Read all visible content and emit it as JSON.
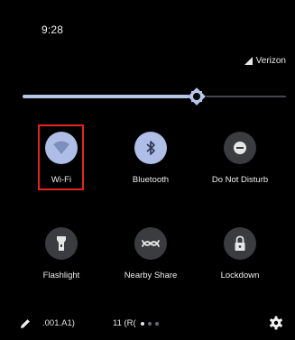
{
  "status_bar": {
    "time": "9:28",
    "carrier": "Verizon",
    "carrier_icon": "signal-icon"
  },
  "brightness": {
    "level_fraction": 0.66
  },
  "tiles": [
    {
      "id": "wifi",
      "label": "Wi-Fi",
      "icon": "wifi-icon",
      "active": true
    },
    {
      "id": "bluetooth",
      "label": "Bluetooth",
      "icon": "bluetooth-icon",
      "active": true
    },
    {
      "id": "dnd",
      "label": "Do Not Disturb",
      "icon": "do-not-disturb-icon",
      "active": false
    },
    {
      "id": "flashlight",
      "label": "Flashlight",
      "icon": "flashlight-icon",
      "active": false
    },
    {
      "id": "nearby",
      "label": "Nearby Share",
      "icon": "nearby-share-icon",
      "active": false
    },
    {
      "id": "lockdown",
      "label": "Lockdown",
      "icon": "lock-icon",
      "active": false
    }
  ],
  "footer": {
    "build_left": ".001.A1)",
    "build_right": "11 (R(",
    "page_dots": 3,
    "active_dot": 0,
    "edit_icon": "pencil-icon",
    "settings_icon": "gear-icon"
  },
  "colors": {
    "background": "#000000",
    "tile_active": "#aebee6",
    "tile_inactive": "#3b3c40",
    "accent": "#b7c6e8",
    "highlight": "#e0261f"
  }
}
